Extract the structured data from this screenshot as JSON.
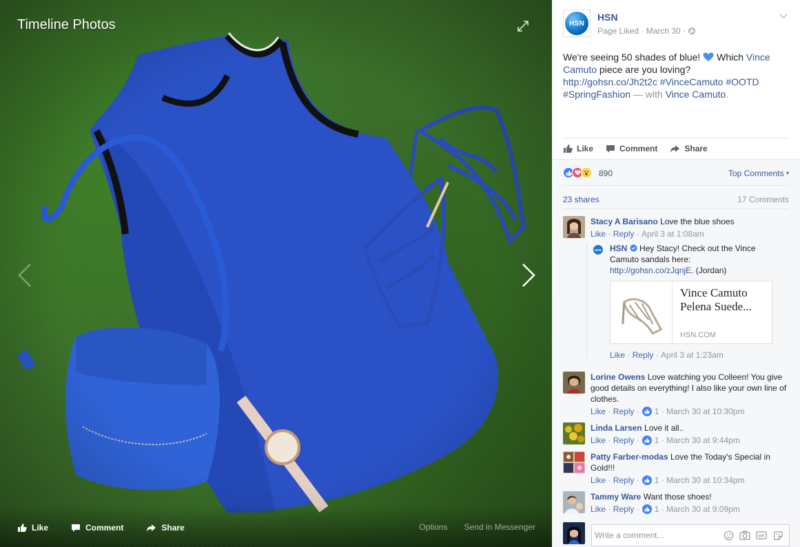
{
  "photo": {
    "title": "Timeline Photos",
    "actions": [
      {
        "label": "Like"
      },
      {
        "label": "Comment"
      },
      {
        "label": "Share"
      }
    ],
    "options_label": "Options",
    "send_label": "Send in Messenger"
  },
  "post": {
    "page_name": "HSN",
    "avatar_text": "HSN",
    "meta": "Page Liked · March 30 ·",
    "text_part1": "We're seeing 50 shades of blue! ",
    "text_part2": " Which ",
    "mention1": "Vince Camuto",
    "text_part3": " piece are you loving?",
    "link": "http://gohsn.co/Jh2t2c",
    "hashtags": "#VinceCamuto #OOTD #SpringFashion",
    "with_text": " — with ",
    "mention2": "Vince Camuto",
    "end": ".",
    "actions": {
      "like": "Like",
      "comment": "Comment",
      "share": "Share"
    }
  },
  "feedback": {
    "reaction_count": "890",
    "top_comments": "Top Comments",
    "shares": "23 shares",
    "comments": "17 Comments"
  },
  "comments": [
    {
      "name": "Stacy A Barisano",
      "text": " Love the blue shoes",
      "like": "Like",
      "reply": "Reply",
      "time": "April 3 at 1:08am"
    },
    {
      "name": "Lorine Owens",
      "text": " Love watching you Colleen! You give good details on everything! I also like your own line of clothes.",
      "like": "Like",
      "reply": "Reply",
      "likes": "1",
      "time": "March 30 at 10:30pm"
    },
    {
      "name": "Linda Larsen",
      "text": " Love it all..",
      "like": "Like",
      "reply": "Reply",
      "likes": "1",
      "time": "March 30 at 9:44pm"
    },
    {
      "name": "Patty Farber-modas",
      "text": " Love the Today's Special in Gold!!!",
      "like": "Like",
      "reply": "Reply",
      "likes": "1",
      "time": "March 30 at 10:34pm"
    },
    {
      "name": "Tammy Ware",
      "text": " Want those shoes!",
      "like": "Like",
      "reply": "Reply",
      "likes": "1",
      "time": "March 30 at 9:09pm"
    }
  ],
  "reply": {
    "name": "HSN",
    "text": " Hey Stacy! Check out the Vince Camuto sandals here:",
    "link": "http://gohsn.co/zJqnjE",
    "suffix": ". (Jordan)",
    "card_title": "Vince Camuto Pelena Suede...",
    "card_domain": "HSN.COM",
    "like": "Like",
    "reply": "Reply",
    "time": "April 3 at 1:23am"
  },
  "composer": {
    "placeholder": "Write a comment..."
  },
  "colors": {
    "accent": "#365899",
    "like_blue": "#4080ff",
    "love_red": "#f25268",
    "wow_yellow": "#fcd240"
  }
}
